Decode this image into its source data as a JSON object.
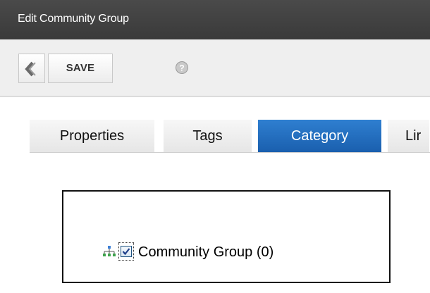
{
  "window": {
    "title": "Edit Community Group"
  },
  "toolbar": {
    "back_icon": "chevron-left-icon",
    "save_label": "SAVE",
    "help_icon": "help-icon"
  },
  "tabs": [
    {
      "label": "Properties",
      "active": false
    },
    {
      "label": "Tags",
      "active": false
    },
    {
      "label": "Category",
      "active": true
    },
    {
      "label": "Lir",
      "active": false
    }
  ],
  "category_tree": {
    "icon": "taxonomy-tree-icon",
    "items": [
      {
        "label": "Community Group (0)",
        "checked": true
      }
    ]
  },
  "colors": {
    "titlebar": "#3d3d3d",
    "active_tab": "#1f6ab8",
    "toolbar_bg": "#efefef"
  }
}
